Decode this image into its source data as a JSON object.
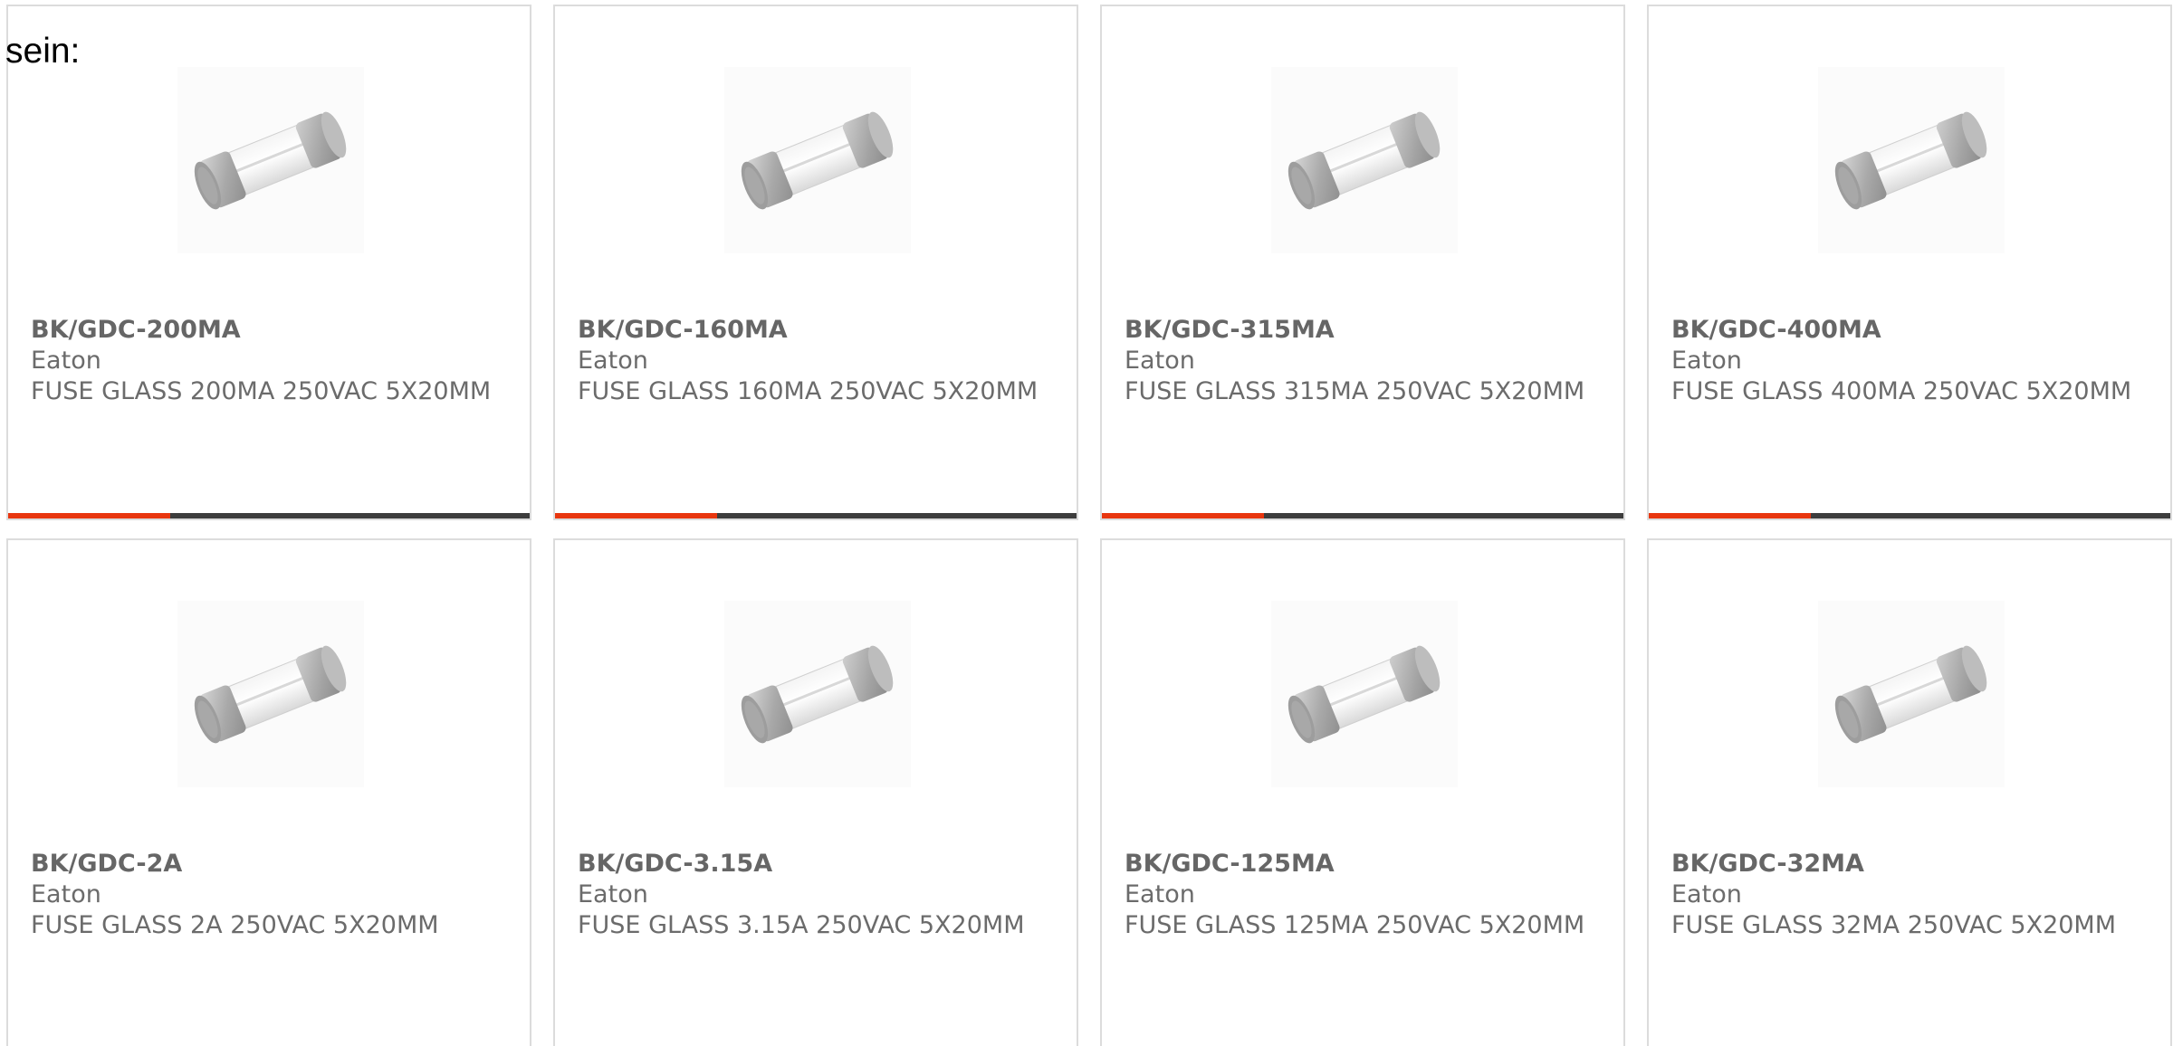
{
  "intro_text": "sein:",
  "colors": {
    "accent": "#e8360f",
    "track": "#3d3d3d",
    "border": "#dcdcdc",
    "text": "#6b6b6b"
  },
  "products": [
    {
      "part": "BK/GDC-200MA",
      "maker": "Eaton",
      "desc": "FUSE GLASS 200MA 250VAC 5X20MM",
      "image_icon": "glass-fuse-icon",
      "progress": 0.31
    },
    {
      "part": "BK/GDC-160MA",
      "maker": "Eaton",
      "desc": "FUSE GLASS 160MA 250VAC 5X20MM",
      "image_icon": "glass-fuse-icon",
      "progress": 0.31
    },
    {
      "part": "BK/GDC-315MA",
      "maker": "Eaton",
      "desc": "FUSE GLASS 315MA 250VAC 5X20MM",
      "image_icon": "glass-fuse-icon",
      "progress": 0.31
    },
    {
      "part": "BK/GDC-400MA",
      "maker": "Eaton",
      "desc": "FUSE GLASS 400MA 250VAC 5X20MM",
      "image_icon": "glass-fuse-icon",
      "progress": 0.31
    },
    {
      "part": "BK/GDC-2A",
      "maker": "Eaton",
      "desc": "FUSE GLASS 2A 250VAC 5X20MM",
      "image_icon": "glass-fuse-icon"
    },
    {
      "part": "BK/GDC-3.15A",
      "maker": "Eaton",
      "desc": "FUSE GLASS 3.15A 250VAC 5X20MM",
      "image_icon": "glass-fuse-icon"
    },
    {
      "part": "BK/GDC-125MA",
      "maker": "Eaton",
      "desc": "FUSE GLASS 125MA 250VAC 5X20MM",
      "image_icon": "glass-fuse-icon"
    },
    {
      "part": "BK/GDC-32MA",
      "maker": "Eaton",
      "desc": "FUSE GLASS 32MA 250VAC 5X20MM",
      "image_icon": "glass-fuse-icon"
    }
  ]
}
